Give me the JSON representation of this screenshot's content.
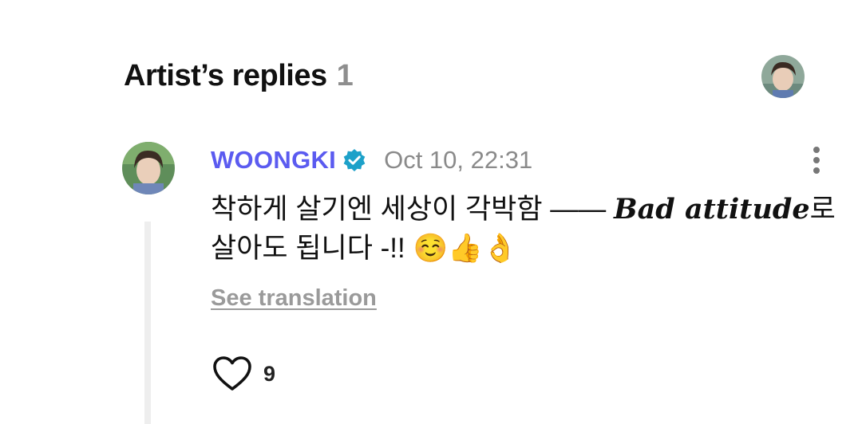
{
  "section": {
    "title": "Artist’s replies",
    "count": "1"
  },
  "comment": {
    "author": "WOONGKI",
    "timestamp": "Oct 10, 22:31",
    "text_line1_korean": "착하게 살기엔 세상이 각박함 ——",
    "text_line1_english": "Bad attitude",
    "text_line1_suffix": "로",
    "text_line2": "살아도 됩니다 -!! ☺️👍👌",
    "see_translation": "See translation",
    "likes": "9"
  },
  "colors": {
    "author": "#5b5bf0",
    "verified_badge": "#1da1c9",
    "muted_text": "#8a8a8a",
    "thread_line": "#eeeeee"
  },
  "icons": {
    "verified": "verified-badge-icon",
    "more": "more-vertical-icon",
    "like": "heart-outline-icon"
  }
}
